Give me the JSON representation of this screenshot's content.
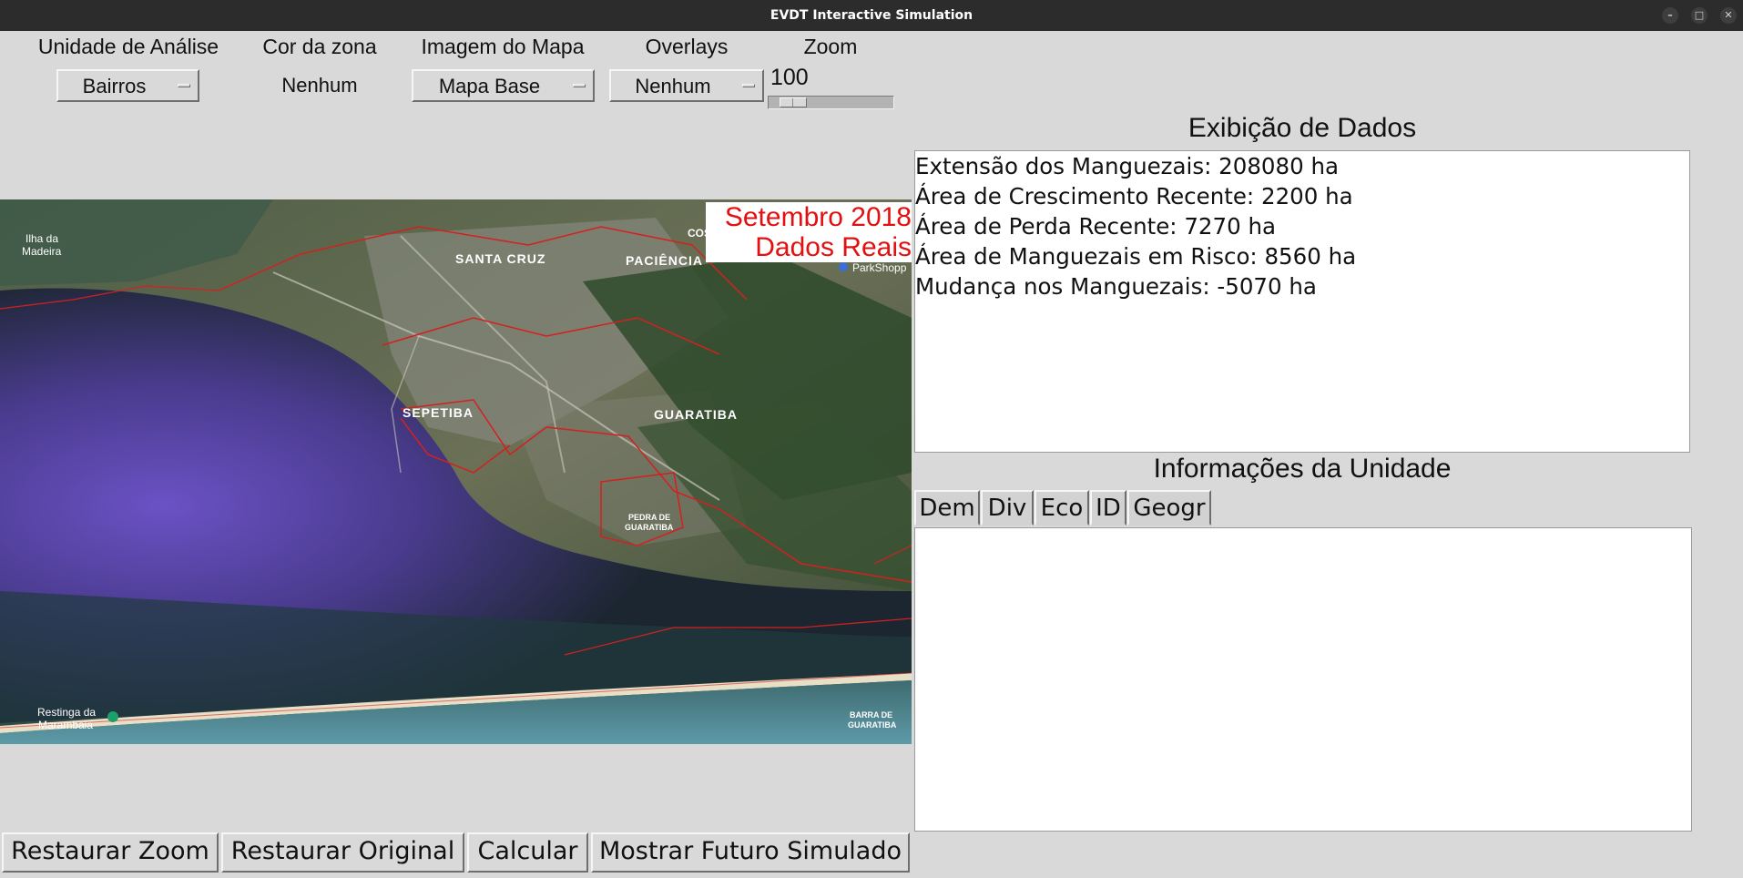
{
  "window": {
    "title": "EVDT Interactive Simulation"
  },
  "controls": {
    "unidade_label": "Unidade de Análise",
    "unidade_value": "Bairros",
    "cor_label": "Cor da zona",
    "cor_value": "Nenhum",
    "imagem_label": "Imagem do Mapa",
    "imagem_value": "Mapa Base",
    "overlays_label": "Overlays",
    "overlays_value": "Nenhum",
    "zoom_label": "Zoom",
    "zoom_value": "100"
  },
  "map": {
    "date_label": "Setembro 2018",
    "source_label": "Dados Reais",
    "places": {
      "ilha": "Ilha da",
      "madeira": "Madeira",
      "santa_cruz": "SANTA CRUZ",
      "paciencia": "PACIÊNCIA",
      "cosmos": "COSMOS",
      "parkshopping": "ParkShopp",
      "sepetiba": "SEPETIBA",
      "guaratiba": "GUARATIBA",
      "pedra": "PEDRA DE",
      "pedra2": "GUARATIBA",
      "restinga": "Restinga da",
      "marambaia": "Marambaia",
      "barra": "BARRA DE",
      "barra2": "GUARATIBA"
    },
    "accent_color": "#e21010"
  },
  "data_panel": {
    "title": "Exibição de Dados",
    "lines": [
      "Extensão dos Manguezais: 208080 ha",
      "Área de Crescimento Recente: 2200 ha",
      "Área de Perda Recente: 7270 ha",
      "Área de Manguezais em Risco: 8560 ha",
      "Mudança nos Manguezais: -5070 ha"
    ]
  },
  "unit_info": {
    "title": "Informações da Unidade",
    "tabs": [
      "Dem",
      "Div",
      "Eco",
      "ID",
      "Geogr"
    ]
  },
  "buttons": {
    "reset_zoom": "Restaurar Zoom",
    "reset_original": "Restaurar Original",
    "calculate": "Calcular",
    "show_future": "Mostrar Futuro Simulado"
  }
}
